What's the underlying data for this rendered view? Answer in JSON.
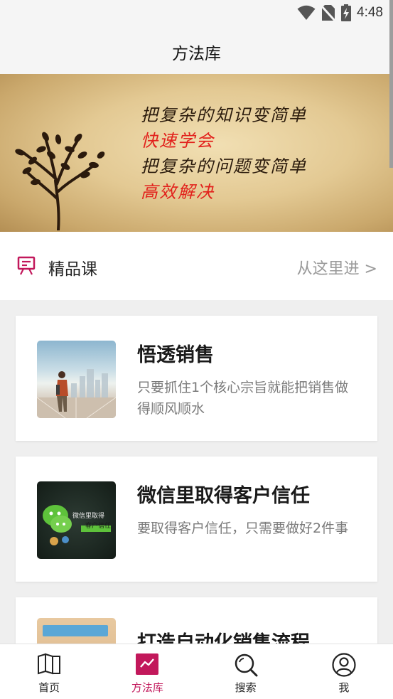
{
  "status_bar": {
    "time": "4:48",
    "icons": [
      "wifi-icon",
      "no-sim-icon",
      "battery-charging-icon"
    ]
  },
  "header": {
    "title": "方法库"
  },
  "banner": {
    "lines": [
      {
        "text": "把复杂的知识变简单",
        "color": "#2a1a0c"
      },
      {
        "text": "快速学会",
        "color": "#e2211c"
      },
      {
        "text": "把复杂的问题变简单",
        "color": "#2a1a0c"
      },
      {
        "text": "高效解决",
        "color": "#e2211c"
      }
    ]
  },
  "section": {
    "icon": "presentation-board-icon",
    "title": "精品课",
    "link": "从这里进 >"
  },
  "cards": [
    {
      "title": "悟透销售",
      "desc": "只要抓住1个核心宗旨就能把销售做得顺风顺水",
      "thumb": "businessman-city-thumbnail"
    },
    {
      "title": "微信里取得客户信任",
      "desc": "要取得客户信任，只需要做好2件事",
      "thumb": "wechat-trust-thumbnail",
      "thumb_text": {
        "line1": "微信里取得",
        "line2": "客户信任"
      }
    },
    {
      "title": "打造自动化销售流程",
      "desc": "",
      "thumb": "sales-process-thumbnail"
    }
  ],
  "bottom_nav": [
    {
      "label": "首页",
      "icon": "book-icon",
      "active": false
    },
    {
      "label": "方法库",
      "icon": "chart-line-icon",
      "active": true
    },
    {
      "label": "搜索",
      "icon": "search-icon",
      "active": false
    },
    {
      "label": "我",
      "icon": "user-icon",
      "active": false
    }
  ],
  "colors": {
    "accent": "#c2185b",
    "banner_red": "#e2211c",
    "muted": "#9a9a9a"
  }
}
